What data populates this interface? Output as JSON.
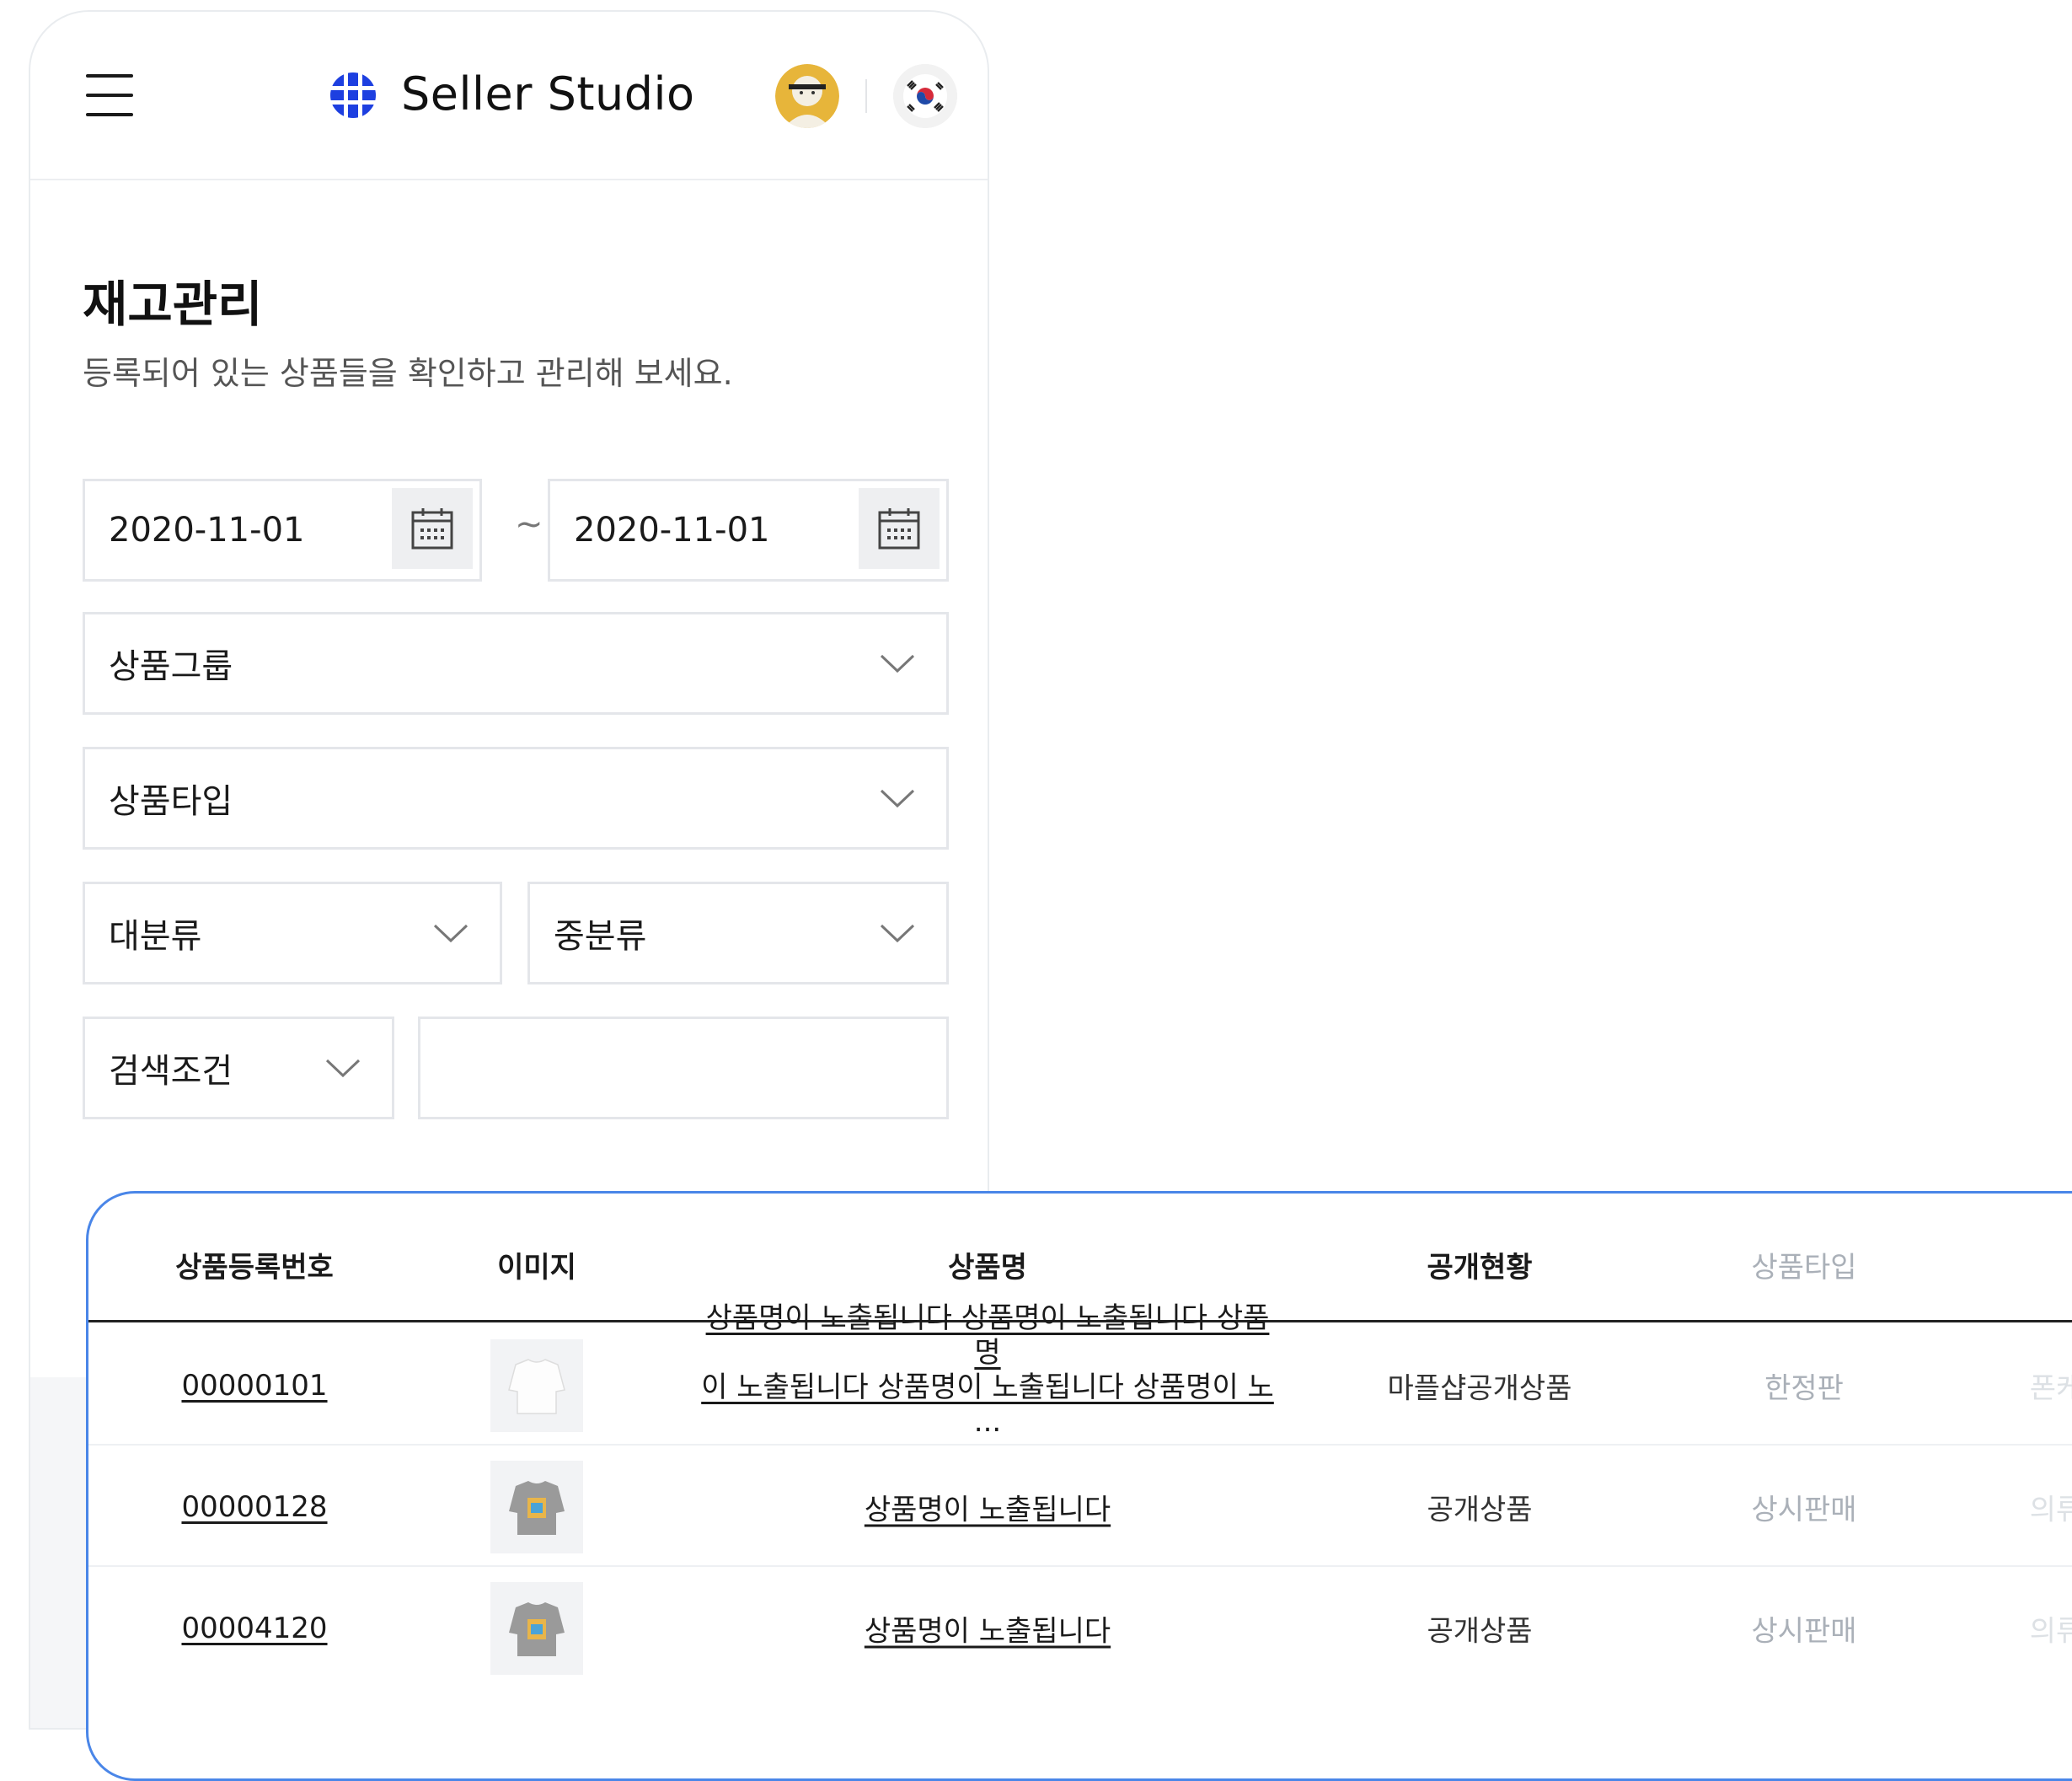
{
  "header": {
    "brand": "Seller Studio"
  },
  "page": {
    "title": "재고관리",
    "description": "등록되어 있는 상품들을 확인하고 관리해 보세요."
  },
  "filters": {
    "date_from": "2020-11-01",
    "date_separator": "~",
    "date_to": "2020-11-01",
    "product_group": "상품그룹",
    "product_type": "상품타입",
    "category_major": "대분류",
    "category_middle": "중분류",
    "search_condition": "검색조건",
    "search_value": ""
  },
  "table": {
    "headers": [
      "상품등록번호",
      "이미지",
      "상품명",
      "공개현황",
      "상품타입"
    ],
    "rows": [
      {
        "id": "00000101",
        "name_line1": "상품명이 노출됩니다 상품명이 노출됩니다 상품명",
        "name_line2": "이 노출됩니다 상품명이 노출됩니다 상품명이 노",
        "name_ellipsis": "...",
        "status": "마플샵공개상품",
        "type": "한정판",
        "extra": "폰케"
      },
      {
        "id": "00000128",
        "name": "상품명이 노출됩니다",
        "status": "공개상품",
        "type": "상시판매",
        "extra": "의류"
      },
      {
        "id": "00004120",
        "name": "상품명이 노출됩니다",
        "status": "공개상품",
        "type": "상시판매",
        "extra": "의류"
      }
    ]
  },
  "icons": {
    "menu": "hamburger-icon",
    "logo": "globe-grid-icon",
    "calendar": "calendar-icon",
    "dropdown": "chevron-down-icon",
    "flag": "korea-flag-icon"
  },
  "colors": {
    "brand_blue": "#1d3fe0",
    "table_border": "#4a86e8"
  }
}
